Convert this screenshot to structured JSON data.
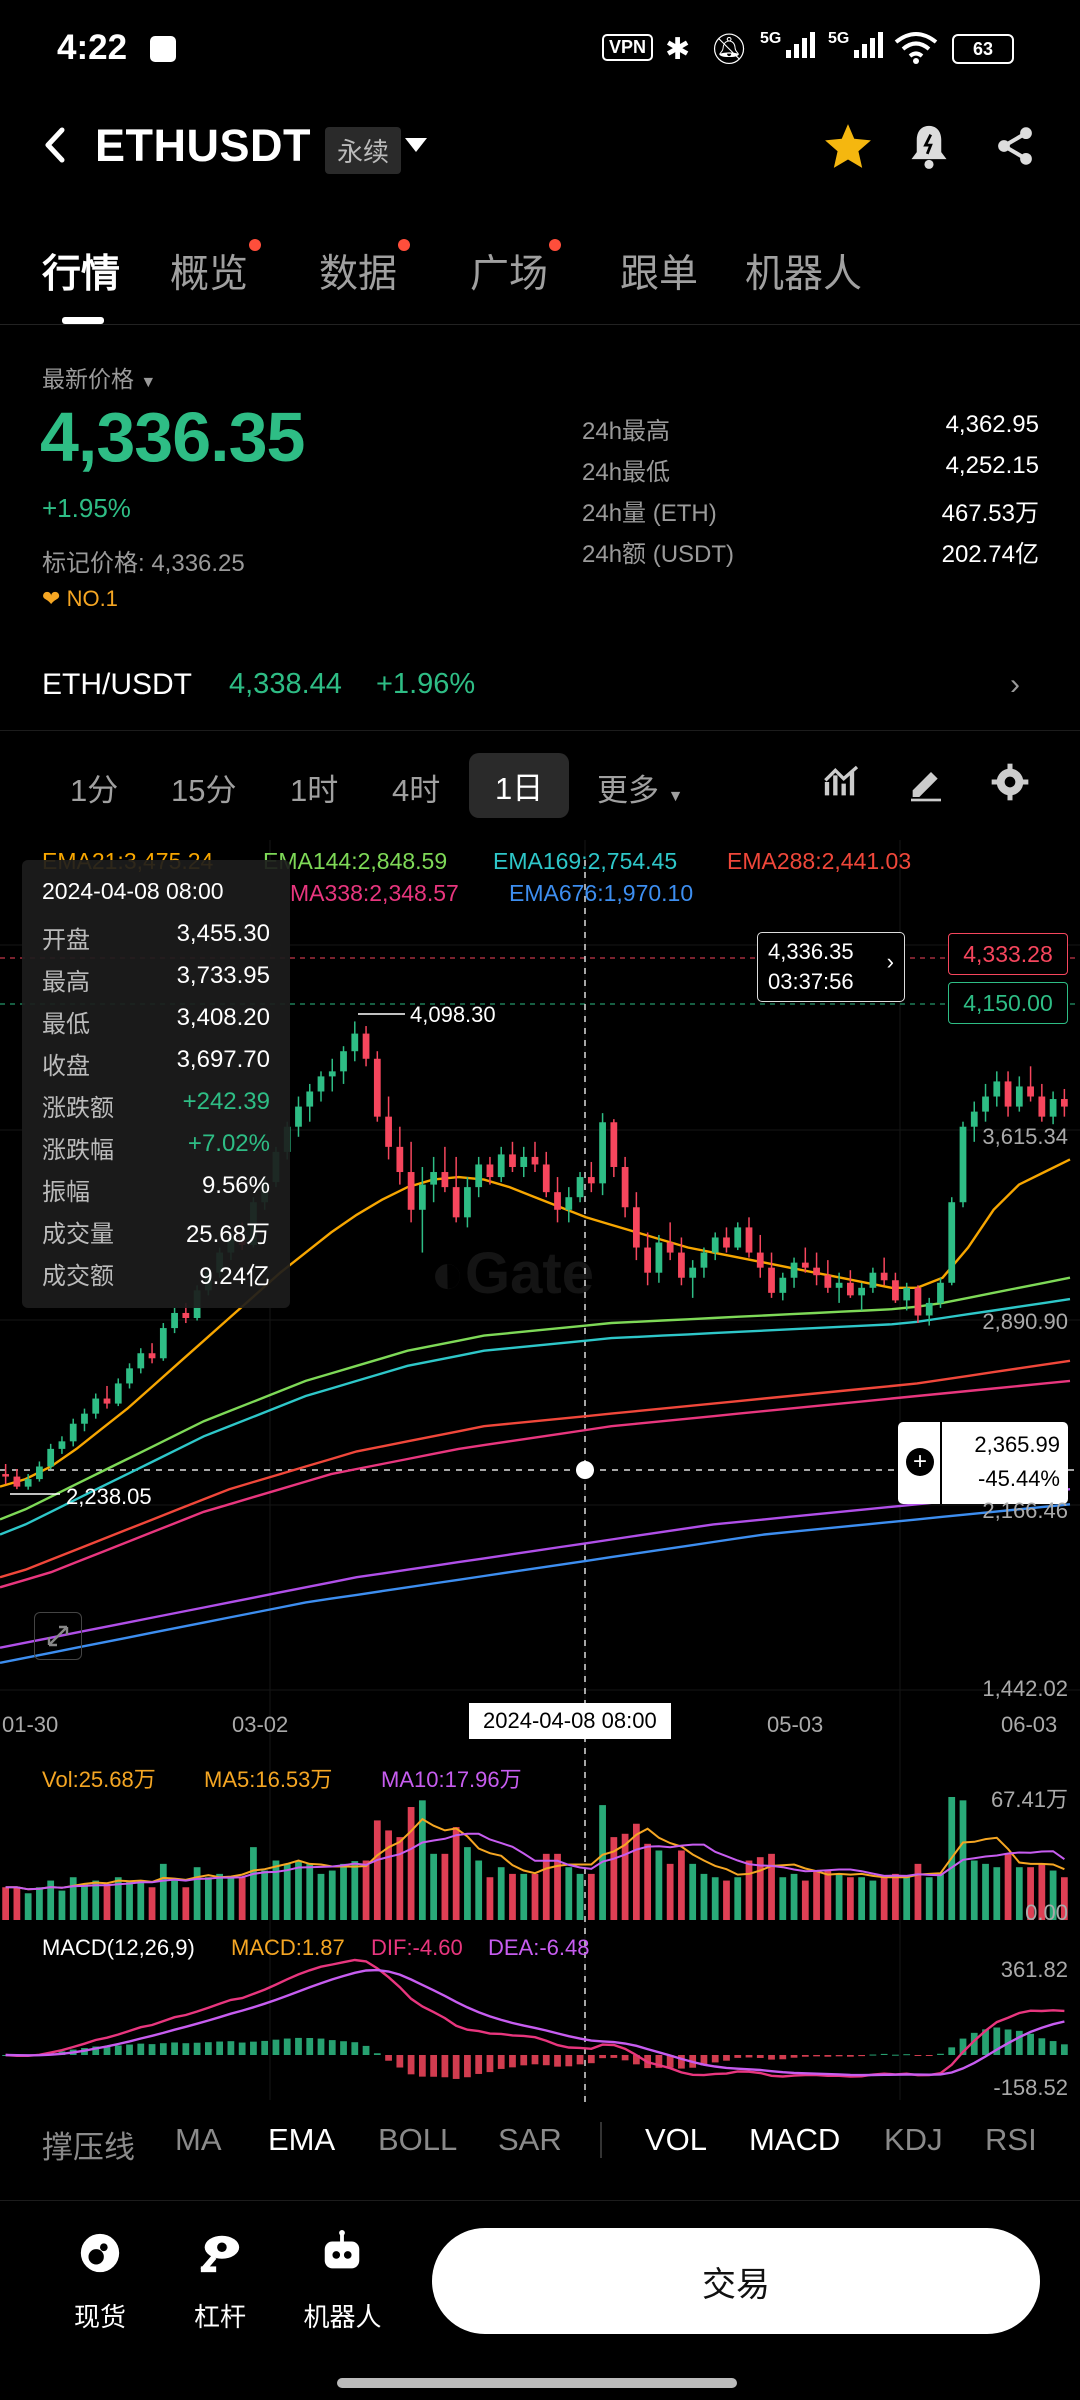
{
  "status_bar": {
    "time": "4:22",
    "vpn": "VPN",
    "signal_1": "5G",
    "signal_2": "5G",
    "battery": "63"
  },
  "header": {
    "pair": "ETHUSDT",
    "contract_type": "永续"
  },
  "tabs": [
    {
      "label": "行情",
      "active": true,
      "dot": false
    },
    {
      "label": "概览",
      "active": false,
      "dot": true
    },
    {
      "label": "数据",
      "active": false,
      "dot": true
    },
    {
      "label": "广场",
      "active": false,
      "dot": true
    },
    {
      "label": "跟单",
      "active": false,
      "dot": false
    },
    {
      "label": "机器人",
      "active": false,
      "dot": false
    }
  ],
  "price": {
    "label": "最新价格",
    "last": "4,336.35",
    "change": "+1.95%",
    "mark_price": "标记价格: 4,336.25",
    "rank": "NO.1"
  },
  "stats": [
    {
      "label": "24h最高",
      "value": "4,362.95"
    },
    {
      "label": "24h最低",
      "value": "4,252.15"
    },
    {
      "label": "24h量 (ETH)",
      "value": "467.53万"
    },
    {
      "label": "24h额 (USDT)",
      "value": "202.74亿"
    }
  ],
  "spot": {
    "pair": "ETH/USDT",
    "price": "4,338.44",
    "change": "+1.96%"
  },
  "intervals": [
    "1分",
    "15分",
    "1时",
    "4时",
    "1日"
  ],
  "active_interval": "1日",
  "more_label": "更多",
  "ema_legend": {
    "ema21": "EMA21:3,475.24",
    "ema144": "EMA144:2,848.59",
    "ema169": "EMA169:2,754.45",
    "ema288": "EMA288:2,441.03",
    "ma338": "MA338:2,348.57",
    "ema676": "EMA676:1,970.10"
  },
  "ohlc_tooltip": {
    "date": "2024-04-08 08:00",
    "rows": [
      {
        "k": "开盘",
        "v": "3,455.30"
      },
      {
        "k": "最高",
        "v": "3,733.95"
      },
      {
        "k": "最低",
        "v": "3,408.20"
      },
      {
        "k": "收盘",
        "v": "3,697.70"
      },
      {
        "k": "涨跌额",
        "v": "+242.39"
      },
      {
        "k": "涨跌幅",
        "v": "+7.02%"
      },
      {
        "k": "振幅",
        "v": "9.56%"
      },
      {
        "k": "成交量",
        "v": "25.68万"
      },
      {
        "k": "成交额",
        "v": "9.24亿"
      }
    ]
  },
  "price_tags": {
    "current": "4,336.35",
    "countdown": "03:37:56",
    "tag_red": "4,333.28",
    "tag_green": "4,150.00",
    "crosshair_price": "2,365.99",
    "crosshair_pct": "-45.44%"
  },
  "chart_data": {
    "type": "candlestick",
    "y_axis_ticks": [
      "3,615.34",
      "2,890.90",
      "2,166.46",
      "1,442.02"
    ],
    "x_axis_ticks": [
      "01-30",
      "03-02",
      "05-03",
      "06-03"
    ],
    "crosshair_date": "2024-04-08 08:00",
    "annotations": {
      "high": "4,098.30",
      "low": "2,238.05"
    },
    "ylim": [
      1442.02,
      4402.0
    ],
    "candles": [
      [
        2300,
        2340,
        2260,
        2290
      ],
      [
        2290,
        2320,
        2240,
        2250
      ],
      [
        2250,
        2300,
        2238,
        2280
      ],
      [
        2280,
        2350,
        2270,
        2330
      ],
      [
        2330,
        2420,
        2320,
        2400
      ],
      [
        2400,
        2450,
        2380,
        2430
      ],
      [
        2430,
        2520,
        2410,
        2500
      ],
      [
        2500,
        2560,
        2470,
        2540
      ],
      [
        2540,
        2620,
        2520,
        2600
      ],
      [
        2600,
        2650,
        2560,
        2580
      ],
      [
        2580,
        2680,
        2570,
        2660
      ],
      [
        2660,
        2740,
        2640,
        2720
      ],
      [
        2720,
        2800,
        2700,
        2780
      ],
      [
        2780,
        2820,
        2740,
        2760
      ],
      [
        2760,
        2900,
        2750,
        2880
      ],
      [
        2880,
        2960,
        2860,
        2940
      ],
      [
        2940,
        2980,
        2900,
        2920
      ],
      [
        2920,
        3050,
        2910,
        3030
      ],
      [
        3030,
        3120,
        3010,
        3100
      ],
      [
        3100,
        3200,
        3080,
        3180
      ],
      [
        3180,
        3260,
        3150,
        3240
      ],
      [
        3240,
        3300,
        3190,
        3210
      ],
      [
        3210,
        3400,
        3200,
        3380
      ],
      [
        3380,
        3480,
        3350,
        3460
      ],
      [
        3460,
        3600,
        3440,
        3580
      ],
      [
        3580,
        3700,
        3550,
        3680
      ],
      [
        3680,
        3800,
        3640,
        3760
      ],
      [
        3760,
        3850,
        3700,
        3820
      ],
      [
        3820,
        3900,
        3780,
        3880
      ],
      [
        3880,
        3950,
        3820,
        3900
      ],
      [
        3900,
        4000,
        3850,
        3980
      ],
      [
        3980,
        4098.3,
        3940,
        4050
      ],
      [
        4050,
        4080,
        3920,
        3950
      ],
      [
        3950,
        3980,
        3700,
        3720
      ],
      [
        3720,
        3800,
        3550,
        3600
      ],
      [
        3600,
        3680,
        3450,
        3500
      ],
      [
        3500,
        3620,
        3300,
        3350
      ],
      [
        3350,
        3520,
        3180,
        3450
      ],
      [
        3450,
        3560,
        3380,
        3500
      ],
      [
        3500,
        3600,
        3420,
        3440
      ],
      [
        3440,
        3560,
        3300,
        3320
      ],
      [
        3320,
        3480,
        3280,
        3440
      ],
      [
        3440,
        3560,
        3400,
        3530
      ],
      [
        3530,
        3560,
        3450,
        3480
      ],
      [
        3480,
        3600,
        3460,
        3570
      ],
      [
        3570,
        3620,
        3500,
        3520
      ],
      [
        3520,
        3600,
        3480,
        3560
      ],
      [
        3560,
        3620,
        3500,
        3530
      ],
      [
        3530,
        3580,
        3400,
        3420
      ],
      [
        3420,
        3480,
        3300,
        3350
      ],
      [
        3350,
        3440,
        3300,
        3400
      ],
      [
        3400,
        3500,
        3380,
        3480
      ],
      [
        3480,
        3540,
        3420,
        3455
      ],
      [
        3455,
        3733.95,
        3408.2,
        3697.7
      ],
      [
        3697.7,
        3710,
        3480,
        3520
      ],
      [
        3520,
        3560,
        3320,
        3360
      ],
      [
        3360,
        3420,
        3150,
        3200
      ],
      [
        3200,
        3260,
        3050,
        3100
      ],
      [
        3100,
        3250,
        3060,
        3220
      ],
      [
        3220,
        3300,
        3150,
        3180
      ],
      [
        3180,
        3240,
        3050,
        3080
      ],
      [
        3080,
        3150,
        3000,
        3120
      ],
      [
        3120,
        3200,
        3080,
        3180
      ],
      [
        3180,
        3260,
        3150,
        3240
      ],
      [
        3240,
        3280,
        3180,
        3200
      ],
      [
        3200,
        3300,
        3190,
        3280
      ],
      [
        3280,
        3320,
        3160,
        3180
      ],
      [
        3180,
        3250,
        3080,
        3120
      ],
      [
        3120,
        3180,
        3000,
        3020
      ],
      [
        3020,
        3100,
        2990,
        3080
      ],
      [
        3080,
        3160,
        3040,
        3140
      ],
      [
        3140,
        3200,
        3100,
        3120
      ],
      [
        3120,
        3180,
        3050,
        3090
      ],
      [
        3090,
        3150,
        3020,
        3040
      ],
      [
        3040,
        3100,
        2980,
        3060
      ],
      [
        3060,
        3110,
        3000,
        3010
      ],
      [
        3010,
        3060,
        2950,
        3040
      ],
      [
        3040,
        3120,
        3020,
        3100
      ],
      [
        3100,
        3160,
        3050,
        3070
      ],
      [
        3070,
        3100,
        2980,
        2990
      ],
      [
        2990,
        3060,
        2950,
        3040
      ],
      [
        3040,
        3050,
        2900,
        2930
      ],
      [
        2930,
        3000,
        2890,
        2980
      ],
      [
        2980,
        3080,
        2960,
        3060
      ],
      [
        3060,
        3400,
        3050,
        3380
      ],
      [
        3380,
        3700,
        3360,
        3680
      ],
      [
        3680,
        3780,
        3620,
        3740
      ],
      [
        3740,
        3850,
        3700,
        3800
      ],
      [
        3800,
        3900,
        3760,
        3860
      ],
      [
        3860,
        3900,
        3720,
        3760
      ],
      [
        3760,
        3880,
        3740,
        3840
      ],
      [
        3840,
        3920,
        3780,
        3800
      ],
      [
        3800,
        3850,
        3700,
        3720
      ],
      [
        3720,
        3820,
        3690,
        3790
      ],
      [
        3790,
        3830,
        3720,
        3760
      ]
    ],
    "ema_lines": [
      {
        "name": "EMA21",
        "color": "#f7a600",
        "values": [
          2250,
          2280,
          2330,
          2400,
          2480,
          2560,
          2650,
          2740,
          2830,
          2920,
          3010,
          3100,
          3180,
          3260,
          3330,
          3390,
          3440,
          3470,
          3480,
          3470,
          3440,
          3400,
          3360,
          3320,
          3290,
          3260,
          3230,
          3200,
          3180,
          3160,
          3140,
          3120,
          3100,
          3080,
          3060,
          3040,
          3040,
          3080,
          3200,
          3350,
          3450,
          3500,
          3550
        ]
      },
      {
        "name": "EMA144",
        "color": "#7ed957",
        "values": [
          2120,
          2160,
          2210,
          2260,
          2310,
          2360,
          2410,
          2460,
          2510,
          2550,
          2590,
          2630,
          2670,
          2700,
          2730,
          2760,
          2790,
          2810,
          2830,
          2850,
          2860,
          2870,
          2880,
          2890,
          2900,
          2905,
          2910,
          2915,
          2920,
          2925,
          2930,
          2935,
          2940,
          2945,
          2950,
          2955,
          2965,
          2980,
          3000,
          3020,
          3040,
          3060,
          3080
        ]
      },
      {
        "name": "EMA169",
        "color": "#2ec7c9",
        "values": [
          2060,
          2100,
          2150,
          2200,
          2250,
          2300,
          2350,
          2400,
          2450,
          2490,
          2530,
          2570,
          2610,
          2640,
          2670,
          2700,
          2730,
          2750,
          2770,
          2790,
          2800,
          2810,
          2820,
          2830,
          2840,
          2845,
          2850,
          2855,
          2860,
          2865,
          2870,
          2875,
          2880,
          2885,
          2890,
          2895,
          2905,
          2920,
          2935,
          2950,
          2965,
          2980,
          2995
        ]
      },
      {
        "name": "EMA288",
        "color": "#f0473a",
        "values": [
          1890,
          1920,
          1960,
          2000,
          2040,
          2080,
          2120,
          2160,
          2200,
          2240,
          2270,
          2300,
          2330,
          2360,
          2390,
          2410,
          2430,
          2450,
          2470,
          2490,
          2500,
          2510,
          2520,
          2530,
          2540,
          2550,
          2560,
          2570,
          2580,
          2590,
          2600,
          2610,
          2620,
          2630,
          2640,
          2650,
          2660,
          2675,
          2690,
          2705,
          2720,
          2735,
          2750
        ]
      },
      {
        "name": "MA338",
        "color": "#e8367e",
        "values": [
          1850,
          1880,
          1910,
          1950,
          1990,
          2030,
          2070,
          2110,
          2150,
          2180,
          2210,
          2240,
          2270,
          2300,
          2320,
          2340,
          2360,
          2380,
          2400,
          2415,
          2430,
          2445,
          2460,
          2475,
          2490,
          2500,
          2510,
          2520,
          2530,
          2540,
          2550,
          2560,
          2570,
          2580,
          2590,
          2600,
          2610,
          2620,
          2630,
          2640,
          2650,
          2660,
          2670
        ]
      },
      {
        "name": "purple",
        "color": "#b04fe8",
        "values": [
          1610,
          1630,
          1650,
          1670,
          1690,
          1710,
          1730,
          1750,
          1770,
          1790,
          1810,
          1830,
          1850,
          1870,
          1890,
          1905,
          1920,
          1935,
          1950,
          1965,
          1980,
          1995,
          2010,
          2025,
          2040,
          2055,
          2070,
          2085,
          2100,
          2110,
          2120,
          2130,
          2140,
          2150,
          2160,
          2170,
          2180,
          2190,
          2200,
          2210,
          2220,
          2230,
          2240
        ]
      },
      {
        "name": "EMA676",
        "color": "#3d8ef0",
        "values": [
          1550,
          1570,
          1590,
          1610,
          1630,
          1650,
          1670,
          1690,
          1710,
          1730,
          1750,
          1770,
          1790,
          1805,
          1820,
          1835,
          1850,
          1865,
          1880,
          1895,
          1910,
          1925,
          1940,
          1955,
          1970,
          1985,
          2000,
          2015,
          2030,
          2045,
          2060,
          2070,
          2080,
          2090,
          2100,
          2110,
          2120,
          2130,
          2140,
          2150,
          2160,
          2170,
          2180
        ]
      }
    ],
    "volume_legend": {
      "vol": "Vol:25.68万",
      "ma5": "MA5:16.53万",
      "ma10": "MA10:17.96万",
      "max": "67.41万",
      "zero": "0.00"
    },
    "macd_legend": {
      "name": "MACD(12,26,9)",
      "macd": "MACD:1.87",
      "dif": "DIF:-4.60",
      "dea": "DEA:-6.48",
      "max": "361.82",
      "min": "-158.52"
    }
  },
  "indicators": [
    {
      "label": "撑压线",
      "active": false
    },
    {
      "label": "MA",
      "active": false
    },
    {
      "label": "EMA",
      "active": true
    },
    {
      "label": "BOLL",
      "active": false
    },
    {
      "label": "SAR",
      "active": false
    },
    {
      "label": "VOL",
      "active": true
    },
    {
      "label": "MACD",
      "active": true
    },
    {
      "label": "KDJ",
      "active": false
    },
    {
      "label": "RSI",
      "active": false
    }
  ],
  "bottom_nav": [
    {
      "label": "现货",
      "icon": "spot-icon"
    },
    {
      "label": "杠杆",
      "icon": "leverage-icon"
    },
    {
      "label": "机器人",
      "icon": "robot-icon"
    }
  ],
  "trade_button": "交易",
  "colors": {
    "up": "#2ebd85",
    "down": "#f6465d",
    "accent": "#f5a623",
    "background": "#000000"
  }
}
